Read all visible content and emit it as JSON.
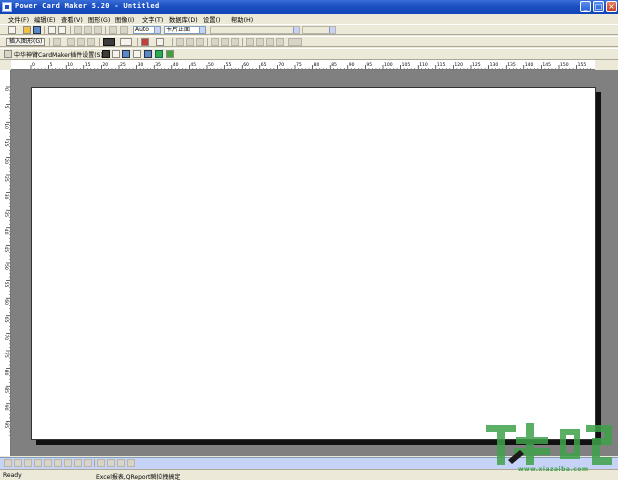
{
  "window": {
    "title": "Power Card Maker 5.20 - Untitled",
    "minimize": "_",
    "maximize": "□",
    "close": "×"
  },
  "menu": [
    "文件(F)",
    "编辑(E)",
    "查看(V)",
    "图形(G)",
    "图像(I)",
    "文字(T)",
    "数据库(D)",
    "设置()",
    "帮助(H)"
  ],
  "toolbar1": {
    "zoom_value": "Auto",
    "side_value": "卡片正面"
  },
  "toolbar2": {
    "insert_shape_label": "插入图形(G)"
  },
  "toolbar3": {
    "plugin_label": "中华神臂CardMaker插件设置(S)"
  },
  "ruler": {
    "h_ticks": [
      "0",
      "5",
      "10",
      "15",
      "20",
      "25",
      "30",
      "35",
      "40",
      "45",
      "50",
      "55",
      "60",
      "65",
      "70",
      "75",
      "80",
      "85",
      "90",
      "95",
      "100",
      "105",
      "110",
      "115",
      "120",
      "125",
      "130",
      "135",
      "140",
      "145",
      "150",
      "155"
    ],
    "v_ticks": [
      "0",
      "5",
      "10",
      "15",
      "20",
      "25",
      "30",
      "35",
      "40",
      "45",
      "50",
      "55",
      "60",
      "65",
      "70",
      "75",
      "80",
      "85",
      "90",
      "95"
    ]
  },
  "status": {
    "ready": "Ready",
    "message": "Excel报表,QReport瞬拉拽搞定"
  },
  "watermark": {
    "text": "www.xiazaiba.com",
    "logo_color": "#3fa24a"
  },
  "colors": {
    "titlebar": "#1c4fc2",
    "workspace": "#808080",
    "card": "#ffffff"
  }
}
